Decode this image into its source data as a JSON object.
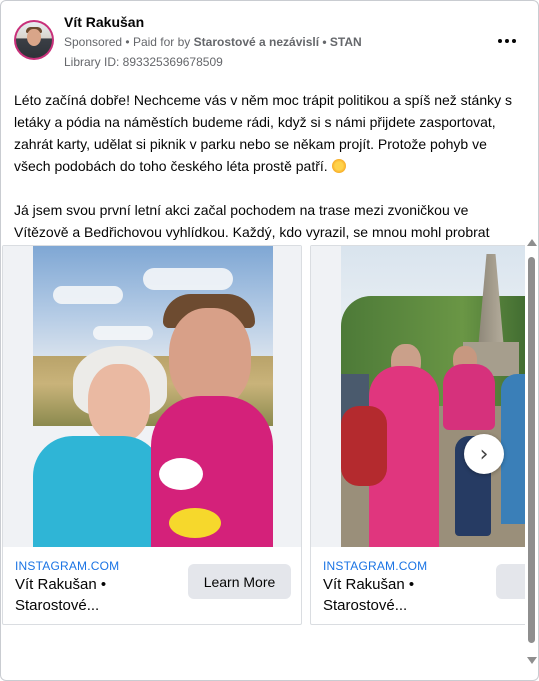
{
  "header": {
    "advertiser_name": "Vít Rakušan",
    "sponsored_label": "Sponsored",
    "paid_for_prefix": "Paid for by",
    "paid_for_by": "Starostové a nezávislí • STAN",
    "library_id": "Library ID: 893325369678509"
  },
  "body": {
    "paragraph1": "Léto začíná dobře! Nechceme vás v něm moc trápit politikou a spíš než stánky s letáky a pódia na náměstích budeme rádi, když si s námi přijdete zasportovat, zahrát karty, udělat si piknik v parku nebo se někam projít. Protože pohyb ve všech podobách do toho českého léta prostě patří.",
    "paragraph2": "Já jsem svou první letní akci začal pochodem na trase mezi zvoničkou ve Vítězově a Bedřichovou vyhlídkou. Každý, kdo vyrazil, se mnou mohl probrat témata od..."
  },
  "carousel": {
    "cards": [
      {
        "source": "INSTAGRAM.COM",
        "caption": "Vít Rakušan • Starostové...",
        "cta": "Learn More"
      },
      {
        "source": "INSTAGRAM.COM",
        "caption": "Vít Rakušan • Starostové...",
        "cta": "Le"
      }
    ],
    "next_icon": "chevron-right-icon"
  },
  "colors": {
    "link": "#1b74e4",
    "muted": "#65676b",
    "button_bg": "#e4e6eb",
    "avatar_ring": "#c8307a"
  }
}
